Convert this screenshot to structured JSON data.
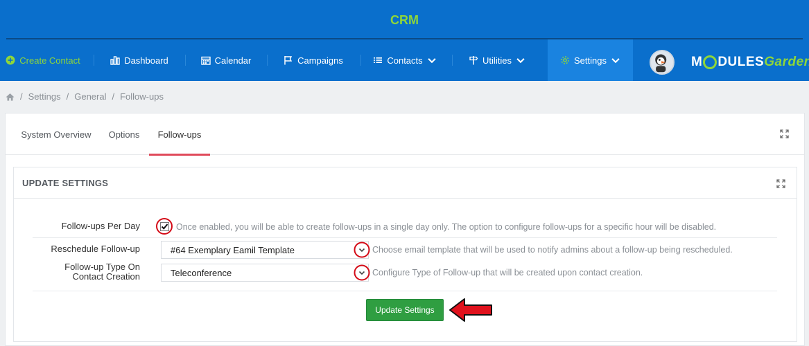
{
  "header": {
    "title": "CRM"
  },
  "nav": {
    "items": [
      {
        "label": "Create Contact",
        "icon": "plus-circle-icon"
      },
      {
        "label": "Dashboard",
        "icon": "bar-chart-icon"
      },
      {
        "label": "Calendar",
        "icon": "calendar-icon"
      },
      {
        "label": "Campaigns",
        "icon": "flag-icon"
      },
      {
        "label": "Contacts",
        "icon": "list-icon"
      },
      {
        "label": "Utilities",
        "icon": "signpost-icon"
      },
      {
        "label": "Settings",
        "icon": "gear-icon"
      }
    ],
    "logo": {
      "part1": "M",
      "part2": "DULES",
      "part3": "Garden"
    }
  },
  "breadcrumb": [
    "Settings",
    "General",
    "Follow-ups"
  ],
  "tabs": [
    "System Overview",
    "Options",
    "Follow-ups"
  ],
  "section": {
    "title": "UPDATE SETTINGS",
    "rows": [
      {
        "label": "Follow-ups Per Day",
        "checked": true,
        "help": "Once enabled, you will be able to create follow-ups in a single day only. The option to configure follow-ups for a specific hour will be disabled."
      },
      {
        "label": "Reschedule Follow-up",
        "value": "#64 Exemplary Eamil Template",
        "help": "Choose email template that will be used to notify admins about a follow-up being rescheduled."
      },
      {
        "label_line1": "Follow-up Type On",
        "label_line2": "Contact Creation",
        "value": "Teleconference",
        "help": "Configure Type of Follow-up that will be created upon contact creation."
      }
    ],
    "button": "Update Settings"
  },
  "colors": {
    "header_bg": "#0a6fcc",
    "accent_green": "#8ed63a",
    "active_tab_underline": "#e04a5a",
    "button_green": "#2f9e41",
    "annotation_red": "#d40b17"
  }
}
